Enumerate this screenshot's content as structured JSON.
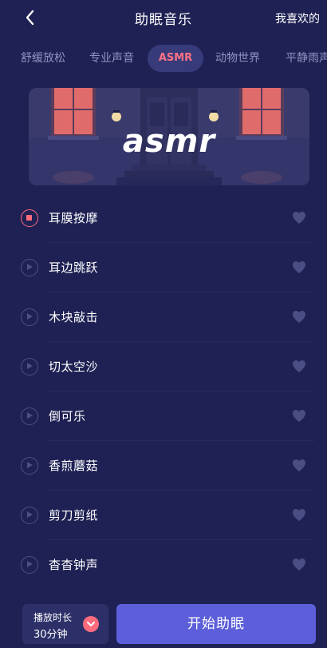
{
  "header": {
    "title": "助眠音乐",
    "right_link": "我喜欢的"
  },
  "tabs": [
    {
      "label": "舒缓放松",
      "active": false
    },
    {
      "label": "专业声音",
      "active": false
    },
    {
      "label": "ASMR",
      "active": true
    },
    {
      "label": "动物世界",
      "active": false
    },
    {
      "label": "平静雨声",
      "active": false
    }
  ],
  "banner": {
    "logo_text": "asmr"
  },
  "tracks": [
    {
      "name": "耳膜按摩",
      "playing": true
    },
    {
      "name": "耳边跳跃",
      "playing": false
    },
    {
      "name": "木块敲击",
      "playing": false
    },
    {
      "name": "切太空沙",
      "playing": false
    },
    {
      "name": "倒可乐",
      "playing": false
    },
    {
      "name": "香煎蘑菇",
      "playing": false
    },
    {
      "name": "剪刀剪纸",
      "playing": false
    },
    {
      "name": "杳杳钟声",
      "playing": false
    }
  ],
  "footer": {
    "duration_label": "播放时长",
    "duration_value": "30分钟",
    "start_button": "开始助眠"
  },
  "colors": {
    "background": "#1f2154",
    "accent": "#ff6b7d",
    "primary_button": "#5c5fd9",
    "active_tab_bg": "#373b7a",
    "heart": "#4b4e83"
  },
  "icons": {
    "back": "chevron-left-icon",
    "play": "play-circle-icon",
    "stop": "stop-circle-icon",
    "favorite": "heart-icon",
    "dropdown": "chevron-down-icon"
  }
}
